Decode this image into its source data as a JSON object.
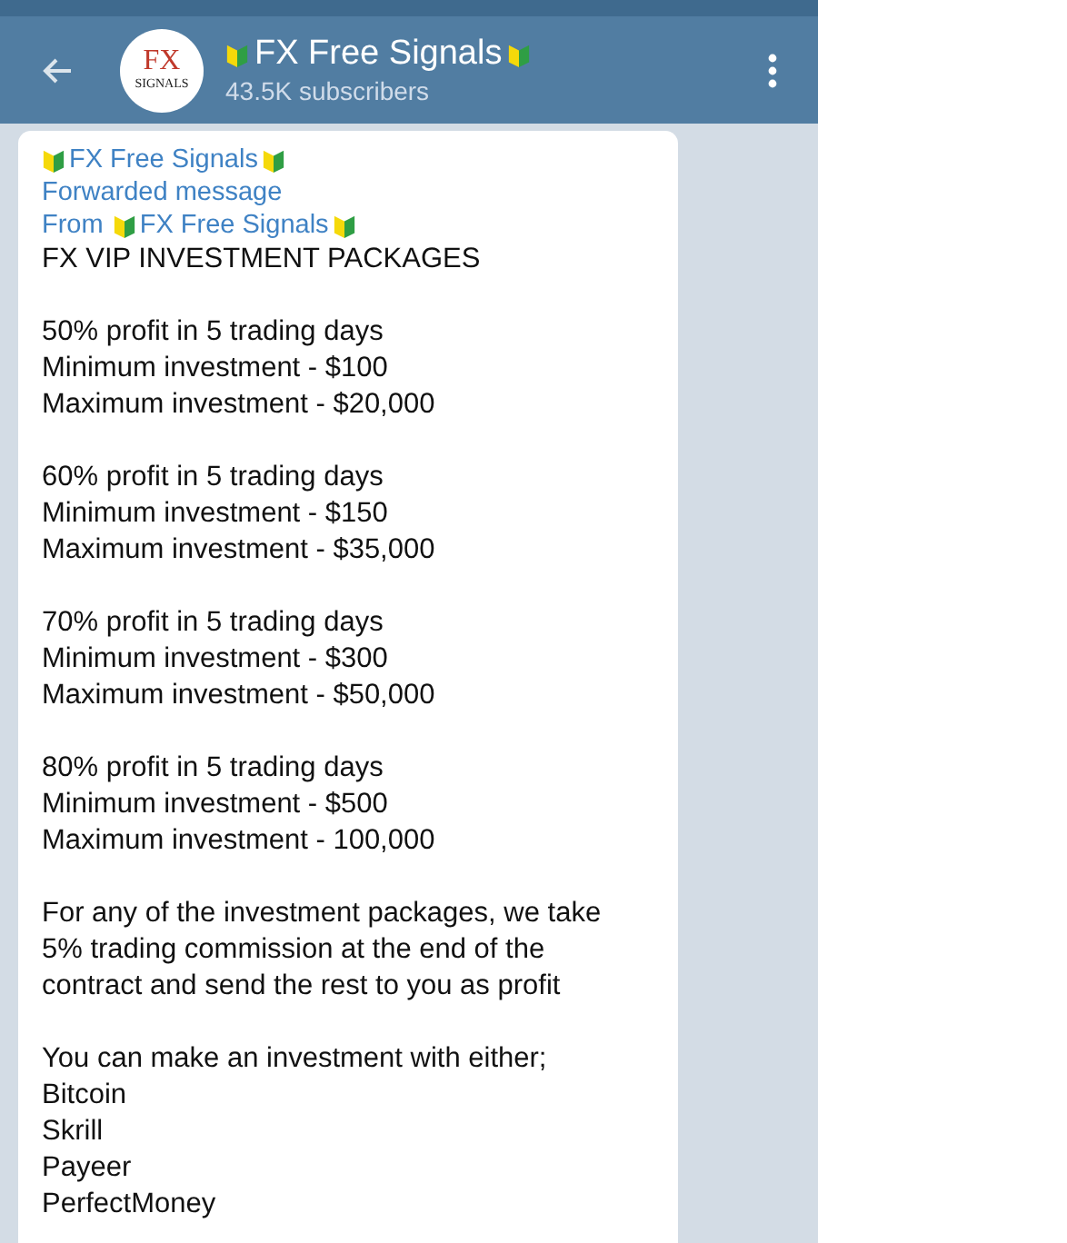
{
  "header": {
    "avatar": {
      "line1": "FX",
      "line2": "SIGNALS"
    },
    "title": "FX Free Signals",
    "subtitle": "43.5K subscribers"
  },
  "message": {
    "forward_source": "FX Free Signals",
    "forward_note": "Forwarded message",
    "from_label": "From",
    "from_name": "FX Free Signals",
    "paragraphs": [
      [
        "FX VIP INVESTMENT PACKAGES"
      ],
      [
        "50% profit in 5 trading days",
        "Minimum investment - $100",
        "Maximum investment - $20,000"
      ],
      [
        "60% profit in 5 trading days",
        "Minimum investment - $150",
        "Maximum investment - $35,000"
      ],
      [
        "70% profit in 5 trading days",
        "Minimum investment - $300",
        "Maximum investment - $50,000"
      ],
      [
        "80% profit in 5 trading days",
        "Minimum investment - $500",
        "Maximum investment - 100,000"
      ],
      [
        "For any of the investment packages, we take",
        "5% trading commission at the end of the",
        "contract and send the rest to you as profit"
      ],
      [
        "You can make an investment with either;",
        "Bitcoin",
        "Skrill",
        "Payeer",
        "PerfectMoney"
      ]
    ]
  }
}
